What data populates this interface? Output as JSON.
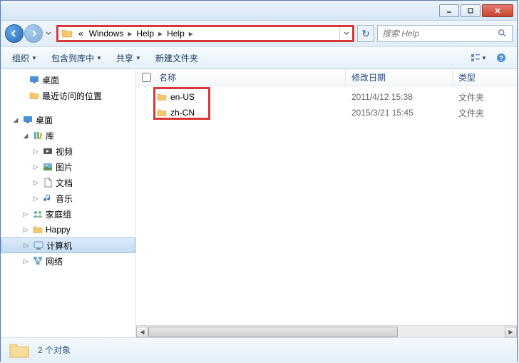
{
  "titlebar": {
    "minimize": "minimize",
    "maximize": "maximize",
    "close": "close"
  },
  "breadcrumbs": {
    "prefix": "«",
    "items": [
      "Windows",
      "Help",
      "Help"
    ]
  },
  "search": {
    "placeholder": "搜索 Help"
  },
  "toolbar": {
    "organize": "组织",
    "include": "包含到库中",
    "share": "共享",
    "newfolder": "新建文件夹"
  },
  "sidebar": {
    "desktop_fav": "桌面",
    "recent": "最近访问的位置",
    "desktop": "桌面",
    "library": "库",
    "video": "视频",
    "pictures": "图片",
    "documents": "文档",
    "music": "音乐",
    "homegroup": "家庭组",
    "happy": "Happy",
    "computer": "计算机",
    "network": "网络"
  },
  "columns": {
    "name": "名称",
    "date": "修改日期",
    "type": "类型"
  },
  "files": [
    {
      "name": "en-US",
      "date": "2011/4/12 15:38",
      "type": "文件夹"
    },
    {
      "name": "zh-CN",
      "date": "2015/3/21 15:45",
      "type": "文件夹"
    }
  ],
  "statusbar": {
    "count": "2 个对象"
  }
}
